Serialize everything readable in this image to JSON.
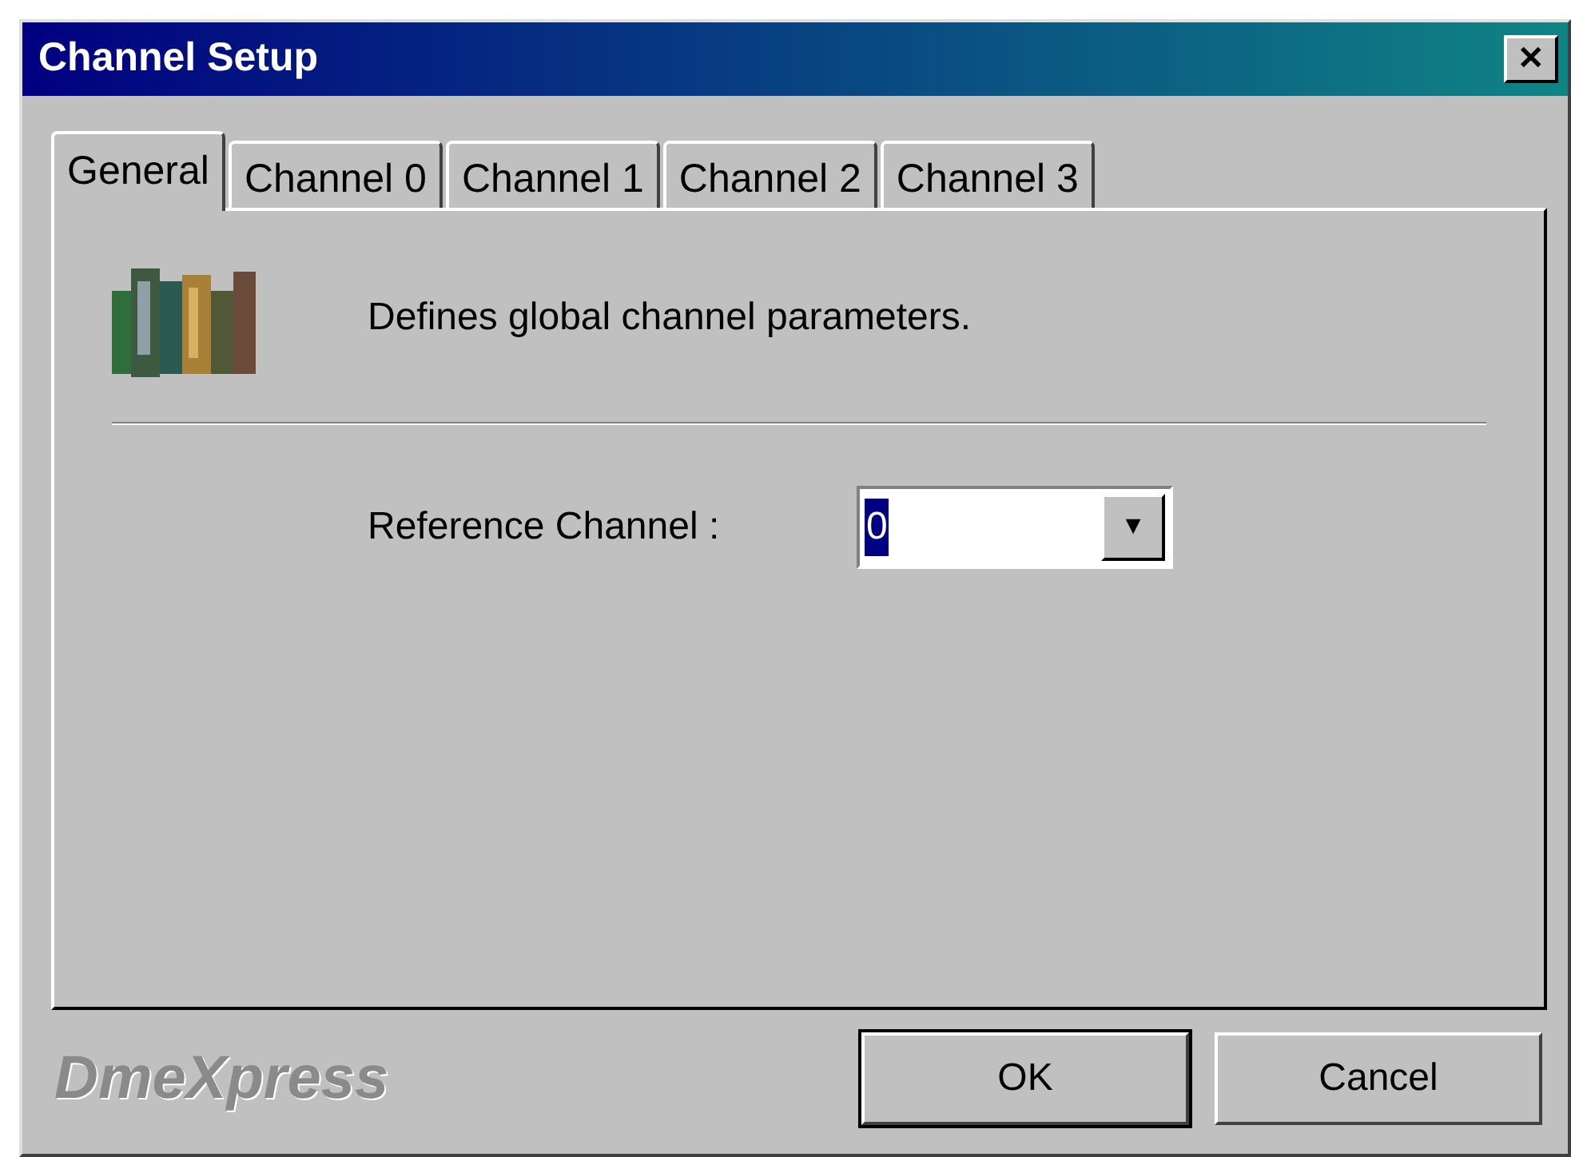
{
  "window": {
    "title": "Channel Setup",
    "close": "✕"
  },
  "tabs": [
    {
      "label": "General",
      "selected": true
    },
    {
      "label": "Channel 0",
      "selected": false
    },
    {
      "label": "Channel 1",
      "selected": false
    },
    {
      "label": "Channel 2",
      "selected": false
    },
    {
      "label": "Channel 3",
      "selected": false
    }
  ],
  "description": "Defines global channel parameters.",
  "reference_channel": {
    "label": "Reference Channel :",
    "value": "0",
    "arrow": "▼"
  },
  "brand": "DmeXpress",
  "buttons": [
    {
      "label": "OK",
      "default": true
    },
    {
      "label": "Cancel",
      "default": false
    }
  ]
}
